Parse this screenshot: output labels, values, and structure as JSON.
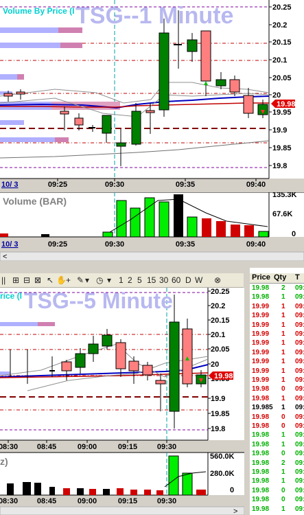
{
  "chart1": {
    "watermark": "TSG--1 Minute",
    "vbp_label": "Volume By Price (I",
    "price_ticks": [
      "20.25",
      "20.2",
      "20.15",
      "20.1",
      "20.05",
      "20",
      "19.95",
      "19.9",
      "19.85",
      "19.8"
    ],
    "last_price": "19.98",
    "time_ticks": [
      "09:25",
      "09:30",
      "09:35",
      "09:40"
    ],
    "date_label": "10/ 3",
    "volume_label": "Volume (BAR)",
    "volume_ticks": [
      "135.3K",
      "67.6K",
      "0"
    ],
    "vol_time_ticks": [
      "09:25",
      "09:30",
      "09:35",
      "09:40"
    ],
    "vol_date_label": "10/ 3"
  },
  "chart2": {
    "watermark": "TSG--5 Minute",
    "vbp_label": "rice (I",
    "price_ticks": [
      "20.25",
      "20.2",
      "20.15",
      "20.1",
      "20.05",
      "20",
      "19.95",
      "19.9",
      "19.85",
      "19.8"
    ],
    "last_price": "19.98",
    "time_ticks": [
      "08:30",
      "08:45",
      "09:00",
      "09:15",
      "09:30"
    ],
    "volume_label": "z)",
    "volume_ticks": [
      "560.0K",
      "280.0K",
      "0"
    ],
    "vol_time_ticks": [
      "08:30",
      "08:45",
      "09:00",
      "09:15",
      "09:30"
    ]
  },
  "toolbar": {
    "intervals": [
      "1",
      "2",
      "5",
      "15",
      "30",
      "60",
      "D",
      "W"
    ]
  },
  "time_sales": {
    "headers": [
      "Price",
      "Qty",
      "T"
    ],
    "rows": [
      {
        "price": "19.98",
        "qty": "2",
        "t": "09:",
        "color": "#00b000"
      },
      {
        "price": "19.98",
        "qty": "1",
        "t": "09:",
        "color": "#00b000"
      },
      {
        "price": "19.99",
        "qty": "1",
        "t": "09:",
        "color": "#d40000"
      },
      {
        "price": "19.99",
        "qty": "1",
        "t": "09:",
        "color": "#d40000"
      },
      {
        "price": "19.99",
        "qty": "1",
        "t": "09:",
        "color": "#d40000"
      },
      {
        "price": "19.99",
        "qty": "1",
        "t": "09:",
        "color": "#d40000"
      },
      {
        "price": "19.99",
        "qty": "1",
        "t": "09:",
        "color": "#d40000"
      },
      {
        "price": "19.99",
        "qty": "1",
        "t": "09:",
        "color": "#d40000"
      },
      {
        "price": "19.99",
        "qty": "1",
        "t": "09:",
        "color": "#d40000"
      },
      {
        "price": "19.99",
        "qty": "1",
        "t": "09:",
        "color": "#d40000"
      },
      {
        "price": "19.99",
        "qty": "1",
        "t": "09:",
        "color": "#d40000"
      },
      {
        "price": "19.98",
        "qty": "0",
        "t": "09:",
        "color": "#d40000"
      },
      {
        "price": "19.98",
        "qty": "1",
        "t": "09:",
        "color": "#d40000"
      },
      {
        "price": "19.985",
        "qty": "1",
        "t": "09:",
        "color": "#000000"
      },
      {
        "price": "19.98",
        "qty": "0",
        "t": "09:",
        "color": "#d40000"
      },
      {
        "price": "19.98",
        "qty": "0",
        "t": "09:",
        "color": "#d40000"
      },
      {
        "price": "19.98",
        "qty": "1",
        "t": "09:",
        "color": "#00b000"
      },
      {
        "price": "19.98",
        "qty": "1",
        "t": "09:",
        "color": "#00b000"
      },
      {
        "price": "19.98",
        "qty": "0",
        "t": "09:",
        "color": "#00b000"
      },
      {
        "price": "19.98",
        "qty": "2",
        "t": "09:",
        "color": "#00b000"
      },
      {
        "price": "19.98",
        "qty": "1",
        "t": "09:",
        "color": "#00b000"
      },
      {
        "price": "19.98",
        "qty": "1",
        "t": "09:",
        "color": "#00b000"
      },
      {
        "price": "19.98",
        "qty": "0",
        "t": "09:",
        "color": "#00b000"
      },
      {
        "price": "19.98",
        "qty": "0",
        "t": "09:",
        "color": "#00b000"
      },
      {
        "price": "19.98",
        "qty": "1",
        "t": "09:",
        "color": "#00b000"
      }
    ]
  },
  "colors": {
    "up_candle": "#008000",
    "down_candle": "#ff7f7f",
    "vbp_up": "#b0b0ff",
    "vbp_down": "#d080b0",
    "vol_up": "#00ee00",
    "vol_down": "#d00000",
    "vol_neutral": "#000000",
    "ma_blue": "#0000c0",
    "ma_red": "#c00000",
    "price_flag": "#e00000"
  }
}
